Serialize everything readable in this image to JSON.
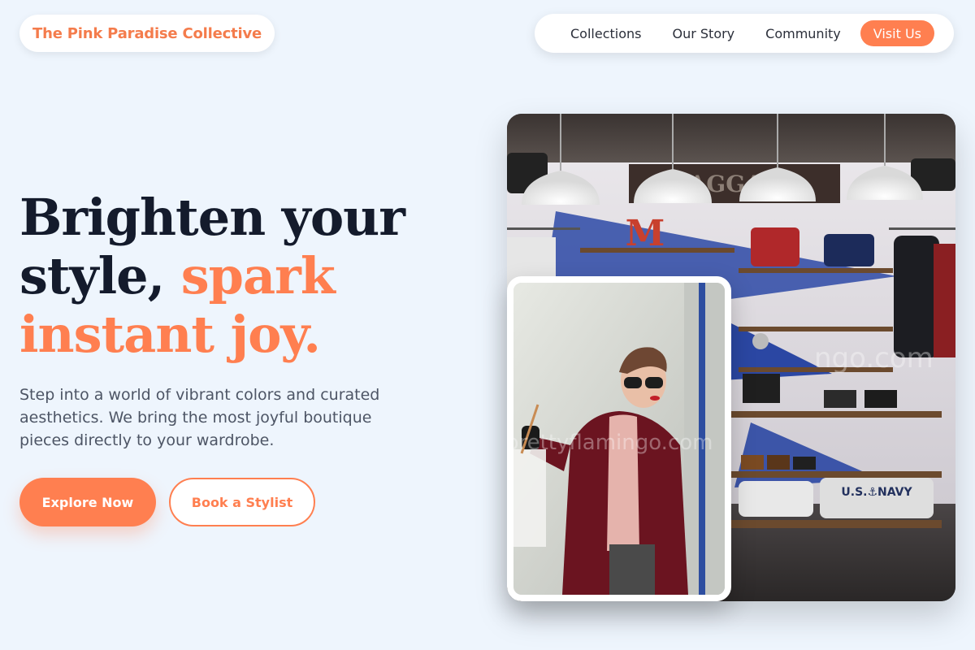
{
  "brand": {
    "name": "The Pink Paradise Collective"
  },
  "nav": {
    "links": [
      "Collections",
      "Our Story",
      "Community"
    ],
    "cta": "Visit Us"
  },
  "hero": {
    "headline_line1": "Brighten your",
    "headline_line2_dark": "style,",
    "headline_line2_accent": "spark",
    "headline_line3_accent": "instant joy.",
    "lead": "Step into a world of vibrant colors and curated aesthetics. We bring the most joyful boutique pieces directly to your wardrobe.",
    "primary_button": "Explore Now",
    "secondary_button": "Book a Stylist"
  },
  "images": {
    "store_sign": "BAGGAGE",
    "store_letter": "M",
    "store_watermark": "ngo.com",
    "shelf_label": "U.S.⚓NAVY",
    "portrait_watermark": "prettyflamingo.com"
  },
  "colors": {
    "accent": "#ff7f50",
    "brand_text": "#f47c4c",
    "heading": "#141b2c",
    "background": "#eef5fd"
  }
}
